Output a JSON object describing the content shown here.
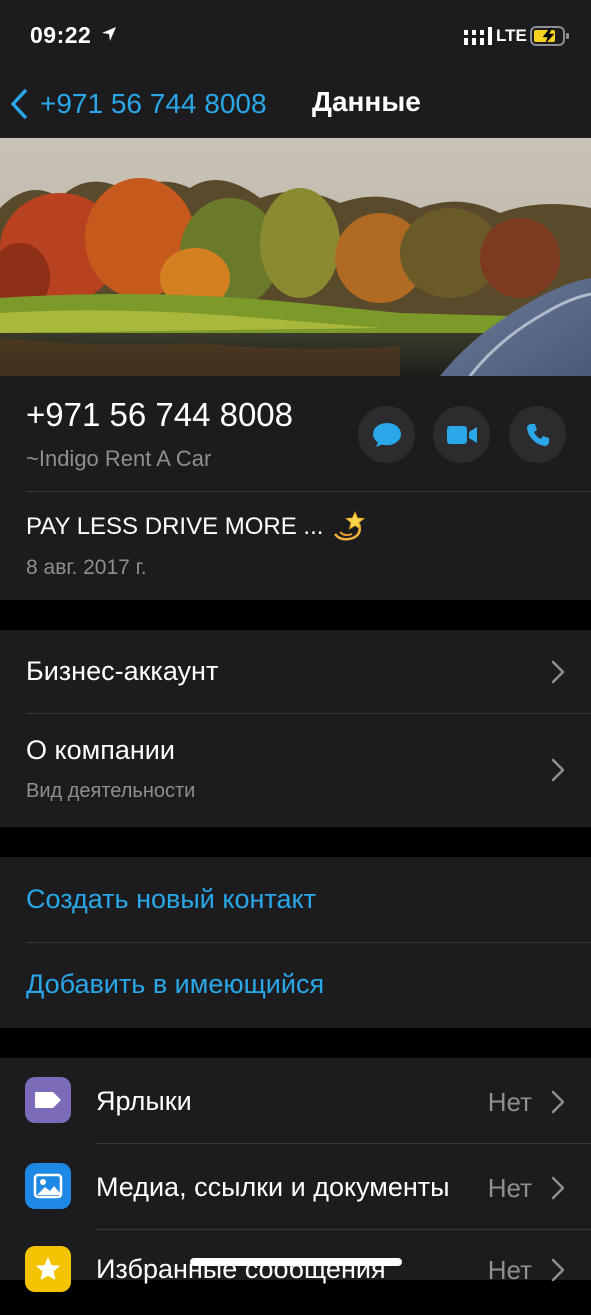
{
  "status_bar": {
    "time": "09:22",
    "network": "LTE",
    "icons": [
      "location-arrow-icon",
      "signal-bars-icon",
      "battery-charging-icon"
    ]
  },
  "nav": {
    "back_label": "+971 56 744 8008",
    "title": "Данные"
  },
  "contact": {
    "phone": "+971 56 744 8008",
    "name": "~Indigo Rent A Car",
    "actions": [
      "message-icon",
      "video-call-icon",
      "phone-call-icon"
    ],
    "about": "PAY LESS DRIVE MORE ...",
    "about_emoji": "dizzy-star-emoji",
    "about_date": "8 авг. 2017 г."
  },
  "business": {
    "account_label": "Бизнес-аккаунт",
    "company_label": "О компании",
    "company_sub": "Вид деятельности"
  },
  "contact_actions": {
    "create_label": "Создать новый контакт",
    "add_existing_label": "Добавить в имеющийся"
  },
  "settings": [
    {
      "label": "Ярлыки",
      "value": "Нет",
      "icon": "label-tag-icon",
      "color": "#7b6bb8"
    },
    {
      "label": "Медиа, ссылки и документы",
      "value": "Нет",
      "icon": "media-photo-icon",
      "color": "#1e88e5"
    },
    {
      "label": "Избранные сообщения",
      "value": "Нет",
      "icon": "star-icon",
      "color": "#f5c400"
    }
  ],
  "colors": {
    "accent": "#2aa7e8",
    "background": "#000000",
    "cell": "#1c1c1e",
    "secondary_text": "#8e8e93"
  }
}
